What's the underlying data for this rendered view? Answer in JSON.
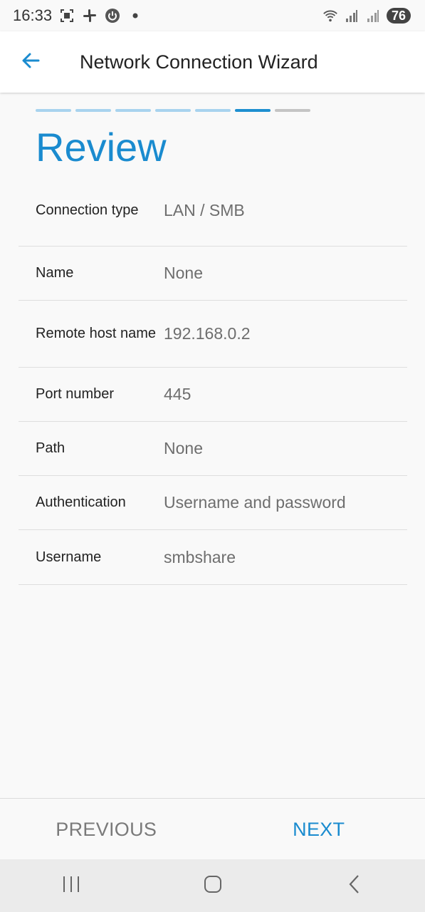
{
  "status_bar": {
    "time": "16:33",
    "battery": "76",
    "icons": [
      "screenshot-icon",
      "slack-icon",
      "power-icon",
      "dot-icon",
      "wifi-icon",
      "signal-icon",
      "signal-icon"
    ]
  },
  "app_bar": {
    "title": "Network Connection Wizard",
    "back_icon": "arrow-left-icon"
  },
  "wizard": {
    "steps_total": 7,
    "current_step": 6,
    "heading": "Review"
  },
  "review": {
    "rows": [
      {
        "label": "Connection type",
        "value": "LAN / SMB"
      },
      {
        "label": "Name",
        "value": "None"
      },
      {
        "label": "Remote host name",
        "value": "192.168.0.2"
      },
      {
        "label": "Port number",
        "value": "445"
      },
      {
        "label": "Path",
        "value": "None"
      },
      {
        "label": "Authentication",
        "value": "Username and password"
      },
      {
        "label": "Username",
        "value": "smbshare"
      }
    ]
  },
  "buttons": {
    "previous": "PREVIOUS",
    "next": "NEXT"
  },
  "colors": {
    "accent": "#1a8bcf",
    "step_done": "#a8d3ee",
    "step_upcoming": "#c4c4c4"
  }
}
